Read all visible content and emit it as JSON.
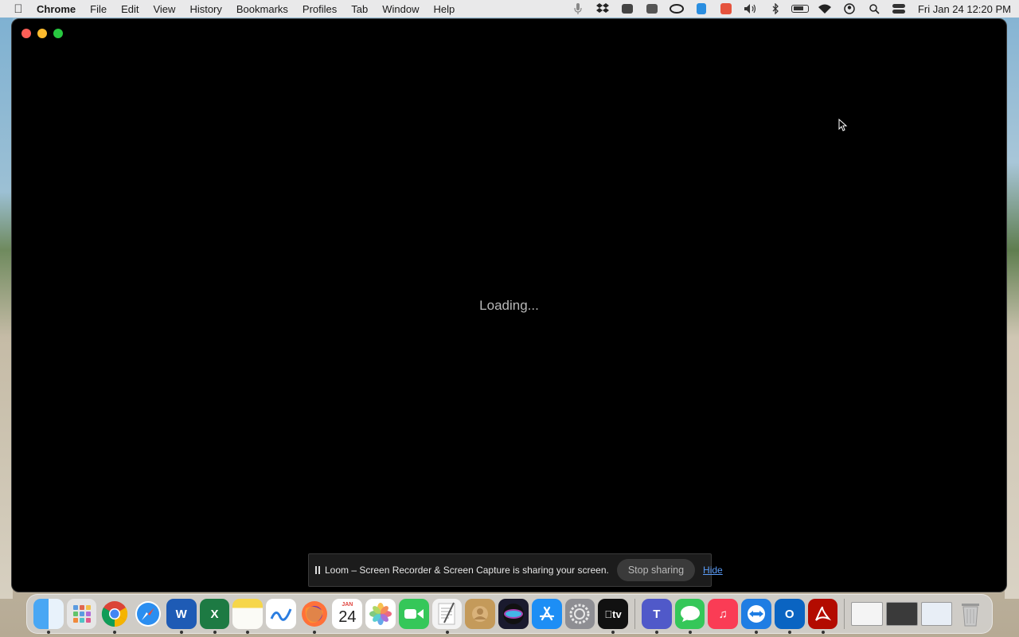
{
  "menubar": {
    "app_name": "Chrome",
    "menus": [
      "File",
      "Edit",
      "View",
      "History",
      "Bookmarks",
      "Profiles",
      "Tab",
      "Window",
      "Help"
    ],
    "clock": "Fri Jan 24  12:20 PM"
  },
  "window": {
    "loading_text": "Loading..."
  },
  "sharebar": {
    "message": "Loom – Screen Recorder & Screen Capture is sharing your screen.",
    "stop_label": "Stop sharing",
    "hide_label": "Hide"
  },
  "dock": {
    "calendar_month": "JAN",
    "calendar_day": "24",
    "tv_label": "tv"
  }
}
